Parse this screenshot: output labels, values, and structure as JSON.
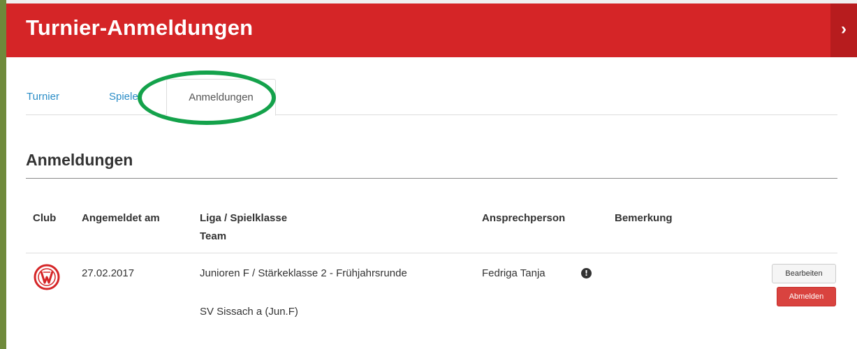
{
  "header": {
    "title": "Turnier-Anmeldungen",
    "arrow_glyph": "›"
  },
  "tabs": [
    {
      "label": "Turnier",
      "active": false
    },
    {
      "label": "Spieler",
      "active": false
    },
    {
      "label": "Anmeldungen",
      "active": true
    }
  ],
  "section": {
    "title": "Anmeldungen"
  },
  "table": {
    "headers": {
      "club": "Club",
      "date": "Angemeldet am",
      "liga": "Liga / Spielklasse",
      "team": "Team",
      "contact": "Ansprechperson",
      "remark": "Bemerkung"
    },
    "rows": [
      {
        "date": "27.02.2017",
        "liga": "Junioren F / Stärkeklasse 2 - Frühjahrsrunde",
        "team": "SV Sissach a (Jun.F)",
        "contact": "Fedriga Tanja",
        "remark": "",
        "info_glyph": "!",
        "edit_label": "Bearbeiten",
        "remove_label": "Abmelden"
      }
    ]
  },
  "colors": {
    "header_bg": "#d52527",
    "link": "#2a8dc7",
    "highlight": "#14a24b",
    "danger_button": "#d9433f"
  }
}
